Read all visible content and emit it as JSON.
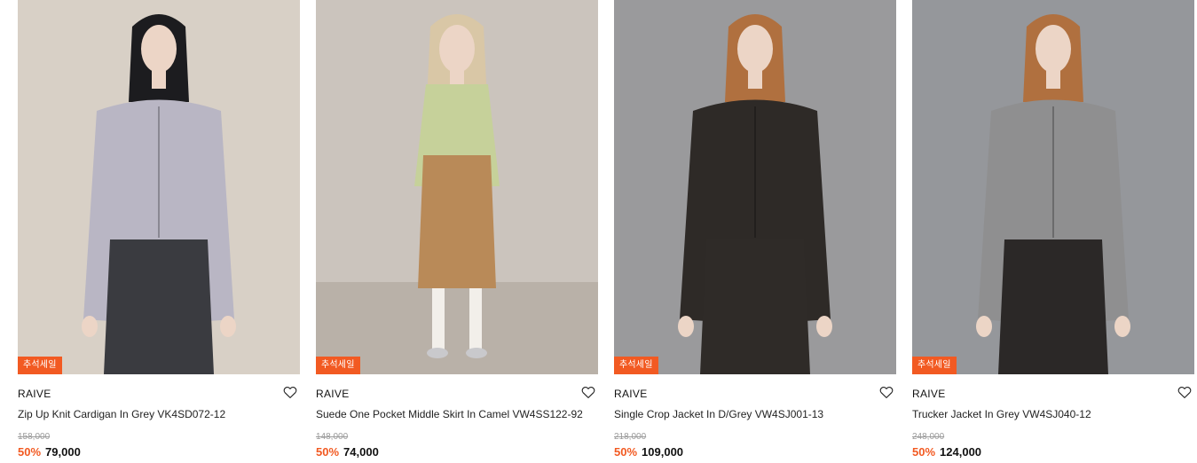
{
  "colors": {
    "accent": "#f25a22"
  },
  "products": [
    {
      "badge": "추석세일",
      "brand": "RAIVE",
      "name": "Zip Up Knit Cardigan In Grey VK4SD072-12",
      "original_price": "158,000",
      "discount": "50%",
      "sale_price": "79,000",
      "wishlist_icon": "heart-outline-icon",
      "photo_bg": "#d8d0c6",
      "garment": "#b9b6c4",
      "bottom": "#3a3b40"
    },
    {
      "badge": "추석세일",
      "brand": "RAIVE",
      "name": "Suede One Pocket Middle Skirt In Camel VW4SS122-92",
      "original_price": "148,000",
      "discount": "50%",
      "sale_price": "74,000",
      "wishlist_icon": "heart-outline-icon",
      "photo_bg": "#cbc4bd",
      "garment": "#c6d19a",
      "bottom": "#b98a58"
    },
    {
      "badge": "추석세일",
      "brand": "RAIVE",
      "name": "Single Crop Jacket In D/Grey VW4SJ001-13",
      "original_price": "218,000",
      "discount": "50%",
      "sale_price": "109,000",
      "wishlist_icon": "heart-outline-icon",
      "photo_bg": "#9a9a9c",
      "garment": "#2e2a27",
      "bottom": "#2f2b28"
    },
    {
      "badge": "추석세일",
      "brand": "RAIVE",
      "name": "Trucker Jacket In Grey VW4SJ040-12",
      "original_price": "248,000",
      "discount": "50%",
      "sale_price": "124,000",
      "wishlist_icon": "heart-outline-icon",
      "photo_bg": "#95979b",
      "garment": "#8f8f90",
      "bottom": "#2b2827"
    }
  ]
}
